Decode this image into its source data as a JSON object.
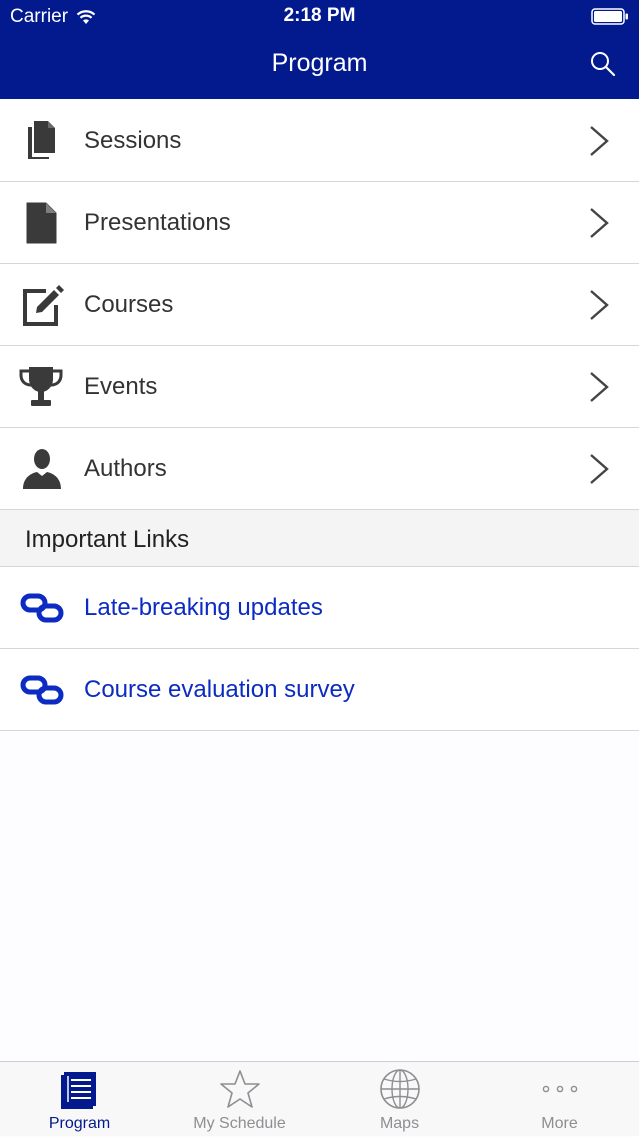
{
  "status_bar": {
    "carrier": "Carrier",
    "time": "2:18 PM"
  },
  "nav": {
    "title": "Program",
    "search_icon": "search-icon"
  },
  "menu": {
    "items": [
      {
        "label": "Sessions",
        "icon": "documents-icon"
      },
      {
        "label": "Presentations",
        "icon": "document-icon"
      },
      {
        "label": "Courses",
        "icon": "edit-icon"
      },
      {
        "label": "Events",
        "icon": "trophy-icon"
      },
      {
        "label": "Authors",
        "icon": "person-icon"
      }
    ]
  },
  "links_section": {
    "title": "Important Links",
    "items": [
      {
        "label": "Late-breaking updates",
        "icon": "link-icon"
      },
      {
        "label": "Course evaluation survey",
        "icon": "link-icon"
      }
    ]
  },
  "tabbar": {
    "tabs": [
      {
        "label": "Program",
        "icon": "program-icon",
        "active": true
      },
      {
        "label": "My Schedule",
        "icon": "star-icon",
        "active": false
      },
      {
        "label": "Maps",
        "icon": "globe-icon",
        "active": false
      },
      {
        "label": "More",
        "icon": "more-icon",
        "active": false
      }
    ]
  },
  "colors": {
    "brand": "#021a8e",
    "link": "#0b2bc2",
    "icon": "#3a3a3a",
    "inactive_tab": "#8e8e93"
  }
}
